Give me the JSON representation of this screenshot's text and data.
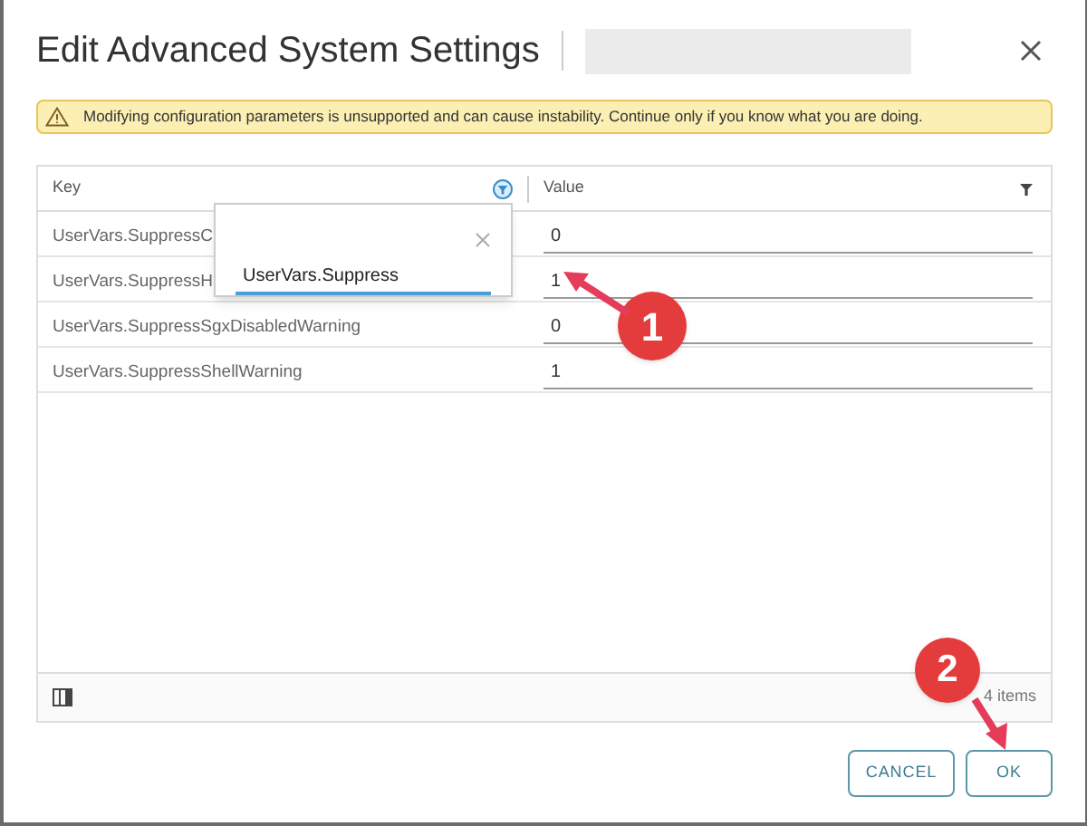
{
  "dialog": {
    "title": "Edit Advanced System Settings"
  },
  "warning": "Modifying configuration parameters is unsupported and can cause instability. Continue only if you know what you are doing.",
  "table": {
    "columns": [
      {
        "label": "Key",
        "filter_active": true
      },
      {
        "label": "Value",
        "filter_active": false
      }
    ],
    "rows": [
      {
        "key": "UserVars.SuppressC",
        "value": "0"
      },
      {
        "key": "UserVars.SuppressH",
        "value": "1"
      },
      {
        "key": "UserVars.SuppressSgxDisabledWarning",
        "value": "0"
      },
      {
        "key": "UserVars.SuppressShellWarning",
        "value": "1"
      }
    ],
    "footer": "4 items"
  },
  "filter_popup": {
    "value": "UserVars.Suppress"
  },
  "callouts": [
    "1",
    "2"
  ],
  "buttons": [
    {
      "label": "CANCEL"
    },
    {
      "label": "OK"
    }
  ]
}
